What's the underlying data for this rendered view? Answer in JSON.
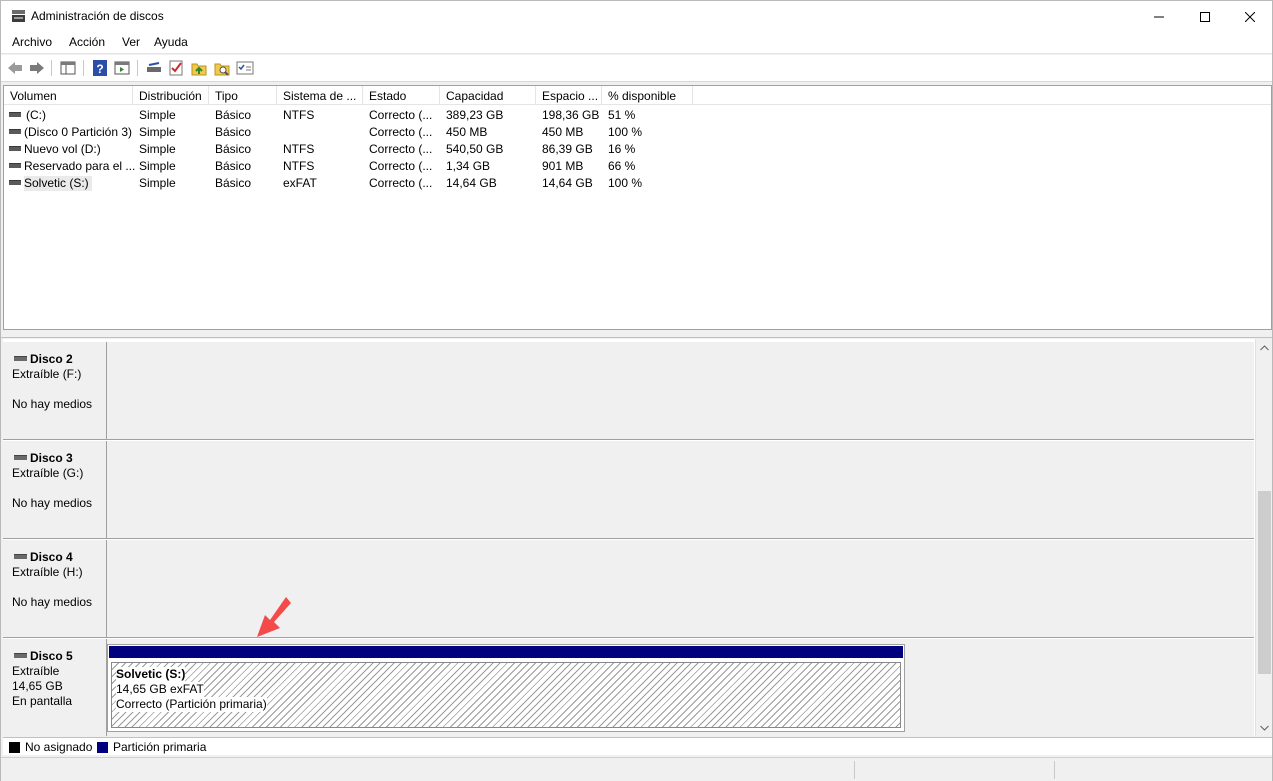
{
  "window": {
    "title": "Administración de discos",
    "controls": {
      "minimize": "minimize",
      "maximize": "maximize",
      "close": "close"
    }
  },
  "menu": {
    "items": [
      "Archivo",
      "Acción",
      "Ver",
      "Ayuda"
    ]
  },
  "toolbar": {
    "buttons": [
      "back-icon",
      "forward-icon",
      "console-tree-icon",
      "help-icon",
      "action-pane-icon",
      "connect-drive-icon",
      "checklist-icon",
      "folder-up-icon",
      "folder-search-icon",
      "properties-icon"
    ]
  },
  "volume_table": {
    "columns": [
      "Volumen",
      "Distribución",
      "Tipo",
      "Sistema de ...",
      "Estado",
      "Capacidad",
      "Espacio ...",
      "% disponible"
    ],
    "rows": [
      {
        "volumen": "(C:)",
        "distribucion": "Simple",
        "tipo": "Básico",
        "sistema": "NTFS",
        "estado": "Correcto (...",
        "capacidad": "389,23 GB",
        "espacio": "198,36 GB",
        "disponible": "51 %"
      },
      {
        "volumen": "(Disco 0 Partición 3)",
        "distribucion": "Simple",
        "tipo": "Básico",
        "sistema": "",
        "estado": "Correcto (...",
        "capacidad": "450 MB",
        "espacio": "450 MB",
        "disponible": "100 %"
      },
      {
        "volumen": "Nuevo vol (D:)",
        "distribucion": "Simple",
        "tipo": "Básico",
        "sistema": "NTFS",
        "estado": "Correcto (...",
        "capacidad": "540,50 GB",
        "espacio": "86,39 GB",
        "disponible": "16 %"
      },
      {
        "volumen": "Reservado para el ...",
        "distribucion": "Simple",
        "tipo": "Básico",
        "sistema": "NTFS",
        "estado": "Correcto (...",
        "capacidad": "1,34 GB",
        "espacio": "901 MB",
        "disponible": "66 %"
      },
      {
        "volumen": "Solvetic (S:)",
        "distribucion": "Simple",
        "tipo": "Básico",
        "sistema": "exFAT",
        "estado": "Correcto (...",
        "capacidad": "14,64 GB",
        "espacio": "14,64 GB",
        "disponible": "100 %"
      }
    ]
  },
  "disks": [
    {
      "name": "Disco 2",
      "line1": "Extraíble (F:)",
      "line2": "",
      "line3": "No hay medios"
    },
    {
      "name": "Disco 3",
      "line1": "Extraíble (G:)",
      "line2": "",
      "line3": "No hay medios"
    },
    {
      "name": "Disco 4",
      "line1": "Extraíble (H:)",
      "line2": "",
      "line3": "No hay medios"
    },
    {
      "name": "Disco 5",
      "line1": "Extraíble",
      "line2": "14,65 GB",
      "line3": "En pantalla"
    }
  ],
  "partition": {
    "name": "Solvetic  (S:)",
    "size": "14,65 GB exFAT",
    "status": "Correcto (Partición primaria)"
  },
  "legend": {
    "unallocated": "No asignado",
    "primary": "Partición primaria",
    "unallocated_color": "#000000",
    "primary_color": "#00007f"
  },
  "colors": {
    "annotation_arrow": "#f44a4a"
  }
}
